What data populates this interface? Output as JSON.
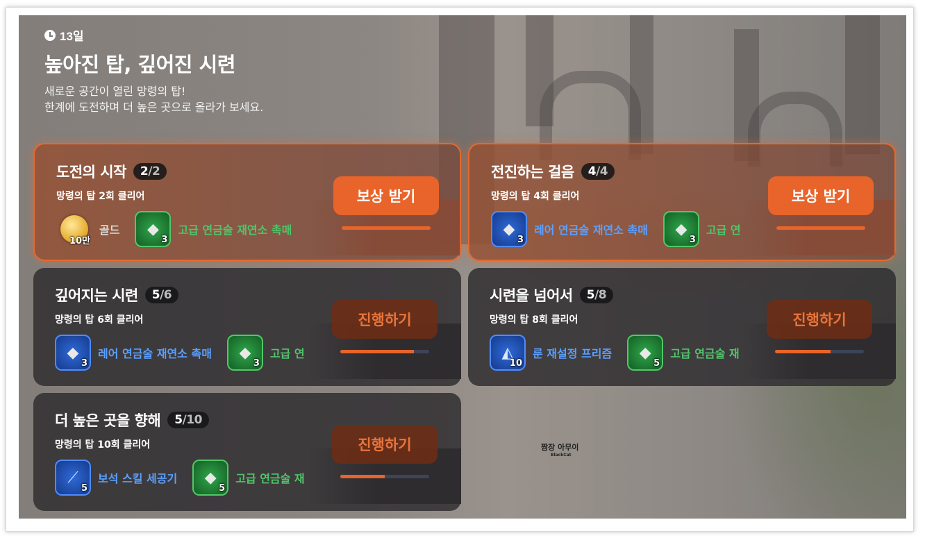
{
  "header": {
    "days": "13일",
    "title": "높아진 탑, 깊어진 시련",
    "subtitle_line1": "새로운 공간이 열린 망령의 탑!",
    "subtitle_line2": "한계에 도전하며 더 높은 곳으로 올라가 보세요."
  },
  "missions": [
    {
      "title": "도전의 시작",
      "current": "2",
      "sep": "/",
      "total": "2",
      "desc": "망령의 탑 2회 클리어",
      "button": "보상 받기",
      "state": "claim",
      "progress": 1.0,
      "rewards": [
        {
          "name": "골드",
          "qty": "10만",
          "type": "gold",
          "icon": "gold-coin-icon"
        },
        {
          "name": "고급 연금술 재연소 촉매",
          "qty": "3",
          "type": "green",
          "icon": "catalyst-icon"
        }
      ]
    },
    {
      "title": "전진하는 걸음",
      "current": "4",
      "sep": "/",
      "total": "4",
      "desc": "망령의 탑 4회 클리어",
      "button": "보상 받기",
      "state": "claim",
      "progress": 1.0,
      "rewards": [
        {
          "name": "레어 연금술 재연소 촉매",
          "qty": "3",
          "type": "blue",
          "icon": "catalyst-icon"
        },
        {
          "name": "고급 연",
          "qty": "3",
          "type": "green",
          "icon": "catalyst-icon"
        }
      ]
    },
    {
      "title": "깊어지는 시련",
      "current": "5",
      "sep": "/",
      "total": "6",
      "desc": "망령의 탑 6회 클리어",
      "button": "진행하기",
      "state": "progress",
      "progress": 0.83,
      "rewards": [
        {
          "name": "레어 연금술 재연소 촉매",
          "qty": "3",
          "type": "blue",
          "icon": "catalyst-icon"
        },
        {
          "name": "고급 연",
          "qty": "3",
          "type": "green",
          "icon": "catalyst-icon"
        }
      ]
    },
    {
      "title": "시련을 넘어서",
      "current": "5",
      "sep": "/",
      "total": "8",
      "desc": "망령의 탑 8회 클리어",
      "button": "진행하기",
      "state": "progress",
      "progress": 0.625,
      "rewards": [
        {
          "name": "룬 재설정 프리즘",
          "qty": "10",
          "type": "blue",
          "icon": "prism-icon"
        },
        {
          "name": "고급 연금술 재",
          "qty": "5",
          "type": "green",
          "icon": "catalyst-icon"
        }
      ]
    },
    {
      "title": "더 높은 곳을 향해",
      "current": "5",
      "sep": "/",
      "total": "10",
      "desc": "망령의 탑 10회 클리어",
      "button": "진행하기",
      "state": "progress",
      "progress": 0.5,
      "rewards": [
        {
          "name": "보석 스킬 세공기",
          "qty": "5",
          "type": "blue",
          "icon": "gem-tool-icon"
        },
        {
          "name": "고급 연금술 재",
          "qty": "5",
          "type": "green",
          "icon": "catalyst-icon"
        }
      ]
    }
  ],
  "watermark": {
    "line1": "짬장 아무이",
    "line2": "BlackCat"
  }
}
